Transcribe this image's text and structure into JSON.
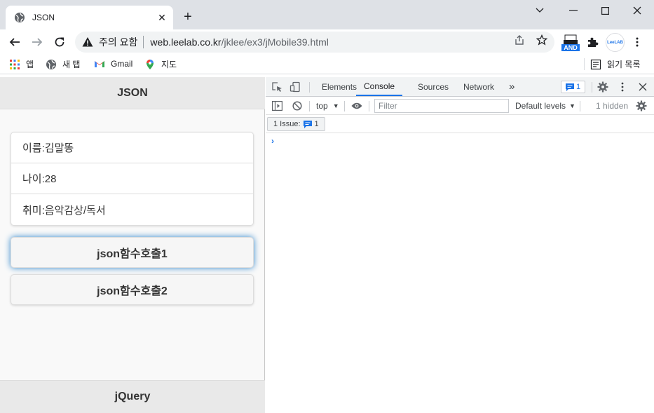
{
  "browser": {
    "tab_title": "JSON",
    "security_label": "주의 요함",
    "url_host": "web.leelab.co.kr",
    "url_path": "/jklee/ex3/jMobile39.html",
    "new_tab": "+",
    "close_tab": "✕",
    "extension_badge": "AND",
    "profile_label": "LeeLAB"
  },
  "bookmarks": {
    "apps": "앱",
    "newtab": "새 탭",
    "gmail": "Gmail",
    "maps": "지도",
    "reading_list": "읽기 목록"
  },
  "page": {
    "header_title": "JSON",
    "items": [
      {
        "label": "이름:김말똥"
      },
      {
        "label": "나이:28"
      },
      {
        "label": "취미:음악감상/독서"
      }
    ],
    "button1": "json함수호출1",
    "button2": "json함수호출2",
    "footer_title": "jQuery"
  },
  "devtools": {
    "tabs": [
      "Elements",
      "Console",
      "Sources",
      "Network"
    ],
    "active_tab": "Console",
    "more_tabs": "»",
    "message_count": "1",
    "context": "top",
    "filter_placeholder": "Filter",
    "levels": "Default levels",
    "hidden_count": "1 hidden",
    "issues_label": "1 Issue:",
    "issues_count": "1",
    "prompt": "›"
  },
  "colors": {
    "accent": "#1a73e8",
    "focus_glow": "#3388cc"
  }
}
